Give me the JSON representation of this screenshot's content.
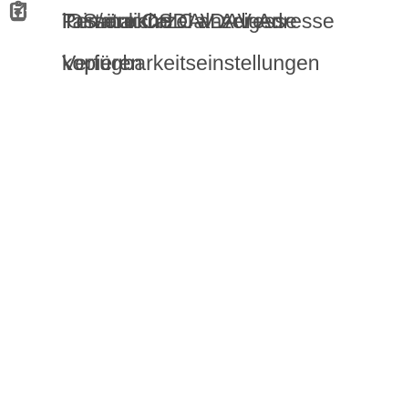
{
  "menu": {
    "items": [
      {
        "icon": "clipboard-arrow-icon",
        "line1": "Primäre CalDAV-Adresse",
        "line2": "kopieren"
      },
      {
        "icon": "clipboard-arrow-icon",
        "line1": "iOS/macOS CalDAV-Adresse",
        "line2": "kopieren"
      },
      {
        "icon": "external-link-icon",
        "line1": "Persönliche",
        "line2": "Verfügbarkeitseinstellungen"
      },
      {
        "icon": "info-icon",
        "line1": "Tastaturkürzel anzeigen"
      }
    ]
  }
}
